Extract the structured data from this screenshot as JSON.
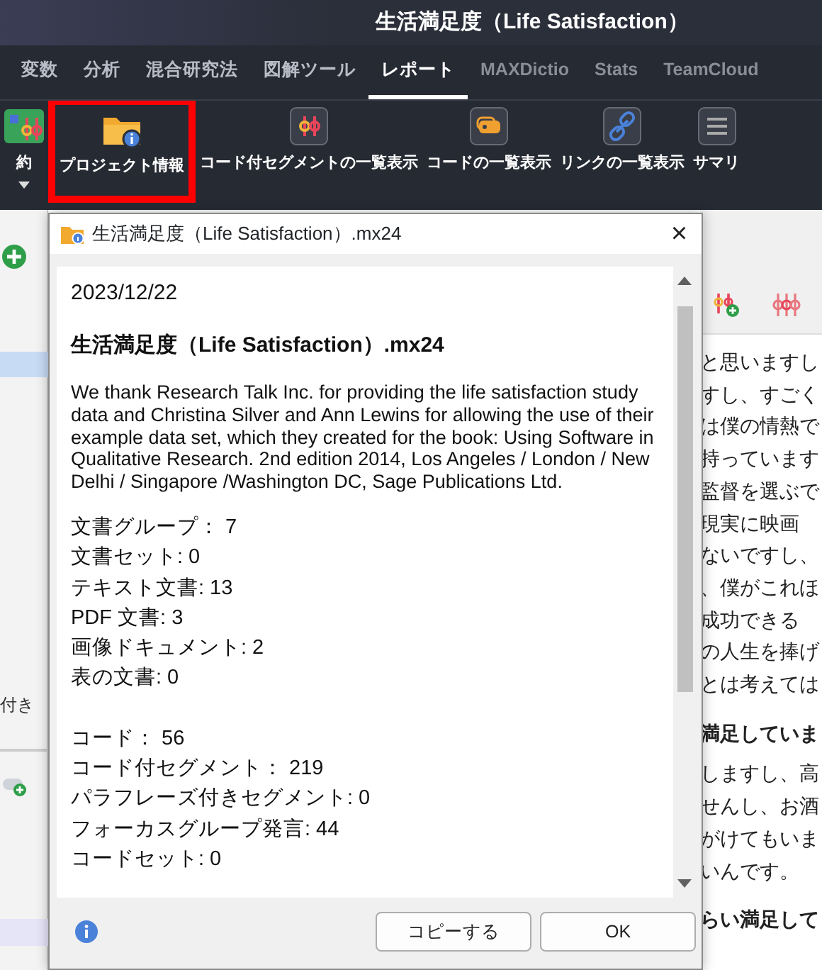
{
  "window": {
    "title": "生活満足度（Life Satisfaction）"
  },
  "tabs": [
    {
      "label": "変数",
      "selected": false,
      "disabled": false
    },
    {
      "label": "分析",
      "selected": false,
      "disabled": false
    },
    {
      "label": "混合研究法",
      "selected": false,
      "disabled": false
    },
    {
      "label": "図解ツール",
      "selected": false,
      "disabled": false
    },
    {
      "label": "レポート",
      "selected": true,
      "disabled": false
    },
    {
      "label": "MAXDictio",
      "selected": false,
      "disabled": true
    },
    {
      "label": "Stats",
      "selected": false,
      "disabled": true
    },
    {
      "label": "TeamCloud",
      "selected": false,
      "disabled": true
    }
  ],
  "ribbon": [
    {
      "kind": "summary",
      "label": "約",
      "highlighted": false,
      "dropdown": true
    },
    {
      "kind": "project",
      "label": "プロジェクト情報",
      "highlighted": true,
      "dropdown": false
    },
    {
      "kind": "segments",
      "label": "コード付セグメントの一覧表示",
      "highlighted": false,
      "dropdown": false
    },
    {
      "kind": "codes",
      "label": "コードの一覧表示",
      "highlighted": false,
      "dropdown": false
    },
    {
      "kind": "links",
      "label": "リンクの一覧表示",
      "highlighted": false,
      "dropdown": false
    },
    {
      "kind": "summary-table",
      "label": "サマリ",
      "highlighted": false,
      "dropdown": false
    }
  ],
  "sidebar": {
    "label": "付き"
  },
  "document_view": {
    "blocks": [
      {
        "kind": "line",
        "text": "と思いますし"
      },
      {
        "kind": "line",
        "text": "すし、すごく"
      },
      {
        "kind": "line",
        "text": "は僕の情熱で"
      },
      {
        "kind": "line",
        "text": "持っています"
      },
      {
        "kind": "line",
        "text": "監督を選ぶで"
      },
      {
        "kind": "line",
        "text": "現実に映画"
      },
      {
        "kind": "line",
        "text": "ないですし、"
      },
      {
        "kind": "line",
        "text": "、僕がこれほ"
      },
      {
        "kind": "line",
        "text": "成功できる"
      },
      {
        "kind": "line",
        "text": "の人生を捧げ"
      },
      {
        "kind": "line",
        "text": "とは考えては"
      },
      {
        "kind": "heading",
        "text": "満足していま"
      },
      {
        "kind": "line",
        "text": "しますし、高"
      },
      {
        "kind": "line",
        "text": "せんし、お酒"
      },
      {
        "kind": "line",
        "text": "がけてもいま"
      },
      {
        "kind": "line",
        "text": "いんです。"
      },
      {
        "kind": "heading",
        "text": "らい満足して"
      }
    ]
  },
  "dialog": {
    "title": "生活満足度（Life Satisfaction）.mx24",
    "close": "×",
    "date": "2023/12/22",
    "heading": "生活満足度（Life Satisfaction）.mx24",
    "description": "We thank Research Talk Inc. for providing the life satisfaction study data and Christina Silver and Ann Lewins for allowing the use of their example data set, which they created for the book: Using Software in Qualitative Research. 2nd edition 2014, Los Angeles / London / New Delhi / Singapore /Washington DC, Sage Publications Ltd.",
    "stats": [
      [
        "文書グループ： 7",
        "文書セット: 0",
        "テキスト文書: 13",
        "PDF 文書: 3",
        "画像ドキュメント: 2",
        "表の文書: 0"
      ],
      [
        "コード： 56",
        "コード付セグメント： 219",
        "パラフレーズ付きセグメント: 0",
        "フォーカスグループ発言: 44",
        "コードセット: 0"
      ]
    ],
    "buttons": [
      {
        "label": "コピーする"
      },
      {
        "label": "OK"
      }
    ]
  }
}
